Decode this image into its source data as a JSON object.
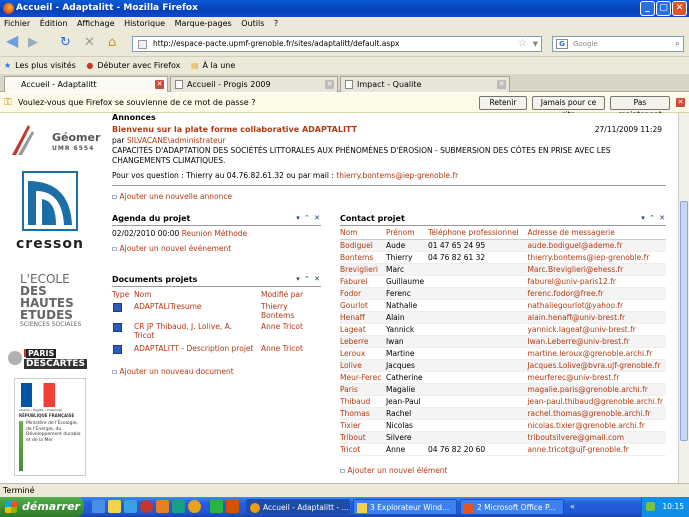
{
  "window": {
    "title": "Accueil - Adaptalitt - Mozilla Firefox"
  },
  "menu": [
    "Fichier",
    "Édition",
    "Affichage",
    "Historique",
    "Marque-pages",
    "Outils",
    "?"
  ],
  "nav": {
    "url": "http://espace-pacte.upmf-grenoble.fr/sites/adaptalitt/default.aspx",
    "search_placeholder": "Google"
  },
  "bookmarks": [
    "Les plus visités",
    "Débuter avec Firefox",
    "À la une"
  ],
  "tabs": [
    "Accueil - Adaptalitt",
    "Accueil - Progis 2009",
    "Impact - Qualite"
  ],
  "password_bar": {
    "text": "Voulez-vous que Firefox se souvienne de ce mot de passe ?",
    "retenir": "Retenir",
    "jamais": "Jamais pour ce site",
    "pas_maintenant": "Pas maintenant"
  },
  "logos": {
    "geomer": "Géomer",
    "geomer_sub": "UMR 6554",
    "cresson": "cresson",
    "ecole_1": "L'ECOLE",
    "ecole_2": "DES HAUTES",
    "ecole_3": "ETUDES",
    "ecole_4": "SCIENCES SOCIALES",
    "ecole_side": "EN",
    "paris": "PARIS",
    "descartes": "DESCARTES",
    "ministere": "Ministère de l'Écologie, de l'Énergie, du Développement durable et de la Mer",
    "republique": "RÉPUBLIQUE FRANÇAISE",
    "liberte": "Liberté • Égalité • Fraternité"
  },
  "annonces": {
    "title": "Annonces",
    "item_title": "Bienvenu sur la plate forme collaborative ADAPTALITT",
    "date": "27/11/2009 11:29",
    "by_prefix": "par",
    "author": "SILVACANE\\administrateur",
    "body": "CAPACITÉS D'ADAPTATION DES SOCIÉTÉS LITTORALES AUX PHÉNOMÈNES D'ÉROSION - SUBMERSION DES CÔTES EN PRISE AVEC LES CHANGEMENTS CLIMATIQUES.",
    "question_prefix": "Pour vos question : Thierry au 04.76.82.61.32 ou par mail :",
    "question_mail": "thierry.bontems@iep-grenoble.fr",
    "add": "Ajouter une nouvelle annonce"
  },
  "agenda": {
    "title": "Agenda du projet",
    "date": "02/02/2010 00:00",
    "event": "Reunion Méthode",
    "add": "Ajouter un nouvel événement"
  },
  "documents": {
    "title": "Documents projets",
    "headers": [
      "Type",
      "Nom",
      "Modifié par"
    ],
    "rows": [
      {
        "name": "ADAPTALITresume",
        "by": "Thierry Bontems"
      },
      {
        "name": "CR JP Thibaud, J. Lolive, A. Tricot",
        "by": "Anne Tricot"
      },
      {
        "name": "ADAPTALITT - Description projet",
        "by": "Anne Tricot"
      }
    ],
    "add": "Ajouter un nouveau document"
  },
  "contacts": {
    "title": "Contact projet",
    "headers": [
      "Nom",
      "Prénom",
      "Téléphone professionnel",
      "Adresse de messagerie"
    ],
    "rows": [
      [
        "Bodiguel",
        "Aude",
        "01 47 65 24 95",
        "aude.bodiguel@ademe.fr"
      ],
      [
        "Bontems",
        "Thierry",
        "04 76 82 61 32",
        "thierry.bontems@iep-grenoble.fr"
      ],
      [
        "Breviglieri",
        "Marc",
        "",
        "Marc.Breviglieri@ehess.fr"
      ],
      [
        "Faburel",
        "Guillaume",
        "",
        "faburel@univ-paris12.fr"
      ],
      [
        "Fodor",
        "Ferenc",
        "",
        "ferenc.fodor@free.fr"
      ],
      [
        "Gourlot",
        "Nathalie",
        "",
        "nathaliegourlot@yahoo.fr"
      ],
      [
        "Henaff",
        "Alain",
        "",
        "alain.henaff@univ-brest.fr"
      ],
      [
        "Lageat",
        "Yannick",
        "",
        "yannick.lageat@univ-brest.fr"
      ],
      [
        "Leberre",
        "Iwan",
        "",
        "Iwan.Leberre@univ-brest.fr"
      ],
      [
        "Leroux",
        "Martine",
        "",
        "martine.leroux@grenoble.archi.fr"
      ],
      [
        "Lolive",
        "Jacques",
        "",
        "Jacques.Lolive@bvra.ujf-grenoble.fr"
      ],
      [
        "Meur-Ferec",
        "Catherine",
        "",
        "meurferec@univ-brest.fr"
      ],
      [
        "Paris",
        "Magalie",
        "",
        "magalie.paris@grenoble.archi.fr"
      ],
      [
        "Thibaud",
        "Jean-Paul",
        "",
        "jean-paul.thibaud@grenoble.archi.fr"
      ],
      [
        "Thomas",
        "Rachel",
        "",
        "rachel.thomas@grenoble.archi.fr"
      ],
      [
        "Tixier",
        "Nicolas",
        "",
        "nicolas.tixier@grenoble.archi.fr"
      ],
      [
        "Tribout",
        "Silvere",
        "",
        "triboutsilvere@gmail.com"
      ],
      [
        "Tricot",
        "Anne",
        "04 76 82 20 60",
        "anne.tricot@ujf-grenoble.fr"
      ]
    ],
    "add": "Ajouter un nouvel élément"
  },
  "status": "Terminé",
  "taskbar": {
    "start": "démarrer",
    "tasks": [
      "Accueil - Adaptalitt - ...",
      "3 Explorateur Wind...",
      "2 Microsoft Office P..."
    ],
    "clock": "10:15"
  },
  "colors": {
    "accent": "#b33a14",
    "header_blue": "#1a3a8c",
    "xp_blue": "#245edb"
  }
}
